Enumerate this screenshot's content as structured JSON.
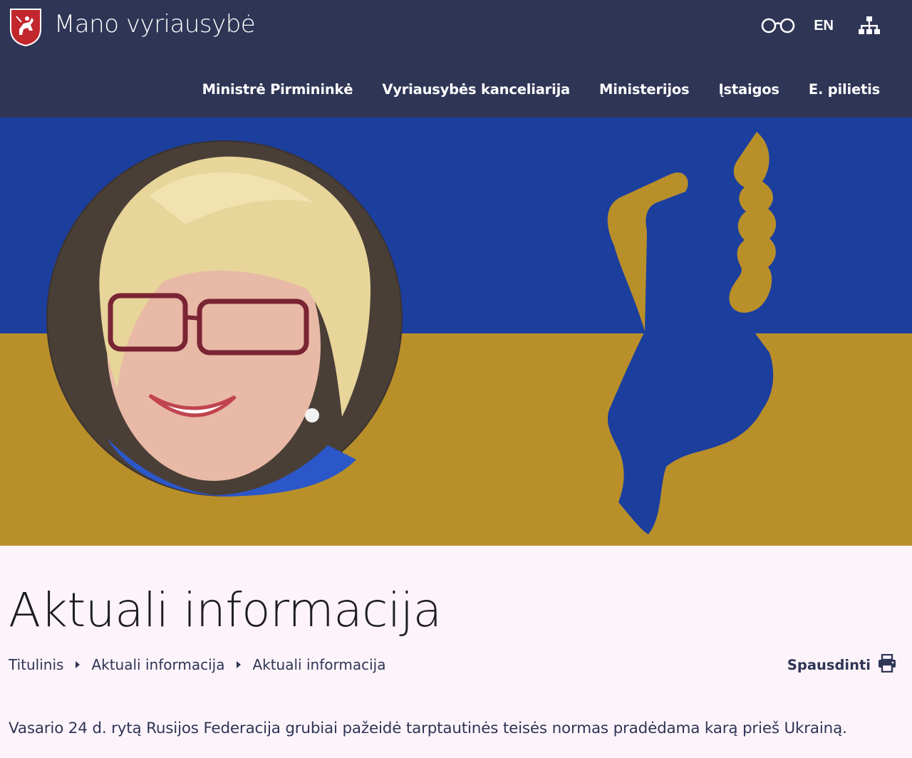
{
  "header": {
    "site_title": "Mano vyriausybė",
    "language_label": "EN",
    "icons": {
      "logo": "lithuania-coat-of-arms-icon",
      "accessibility": "glasses-icon",
      "sitemap": "sitemap-icon"
    },
    "nav": [
      {
        "label": "Ministrė Pirmininkė"
      },
      {
        "label": "Vyriausybės kanceliarija"
      },
      {
        "label": "Ministerijos"
      },
      {
        "label": "Įstaigos"
      },
      {
        "label": "E. pilietis"
      }
    ]
  },
  "banner": {
    "colors": {
      "blue": "#1c3f9e",
      "yellow": "#b98f2a",
      "header": "#2f3555"
    }
  },
  "main": {
    "page_title": "Aktuali informacija",
    "breadcrumb": [
      {
        "label": "Titulinis"
      },
      {
        "label": "Aktuali informacija"
      },
      {
        "label": "Aktuali informacija"
      }
    ],
    "print_label": "Spausdinti",
    "lead_text": "Vasario 24 d. rytą Rusijos Federacija grubiai pažeidė tarptautinės teisės normas pradėdama karą prieš Ukrainą."
  }
}
